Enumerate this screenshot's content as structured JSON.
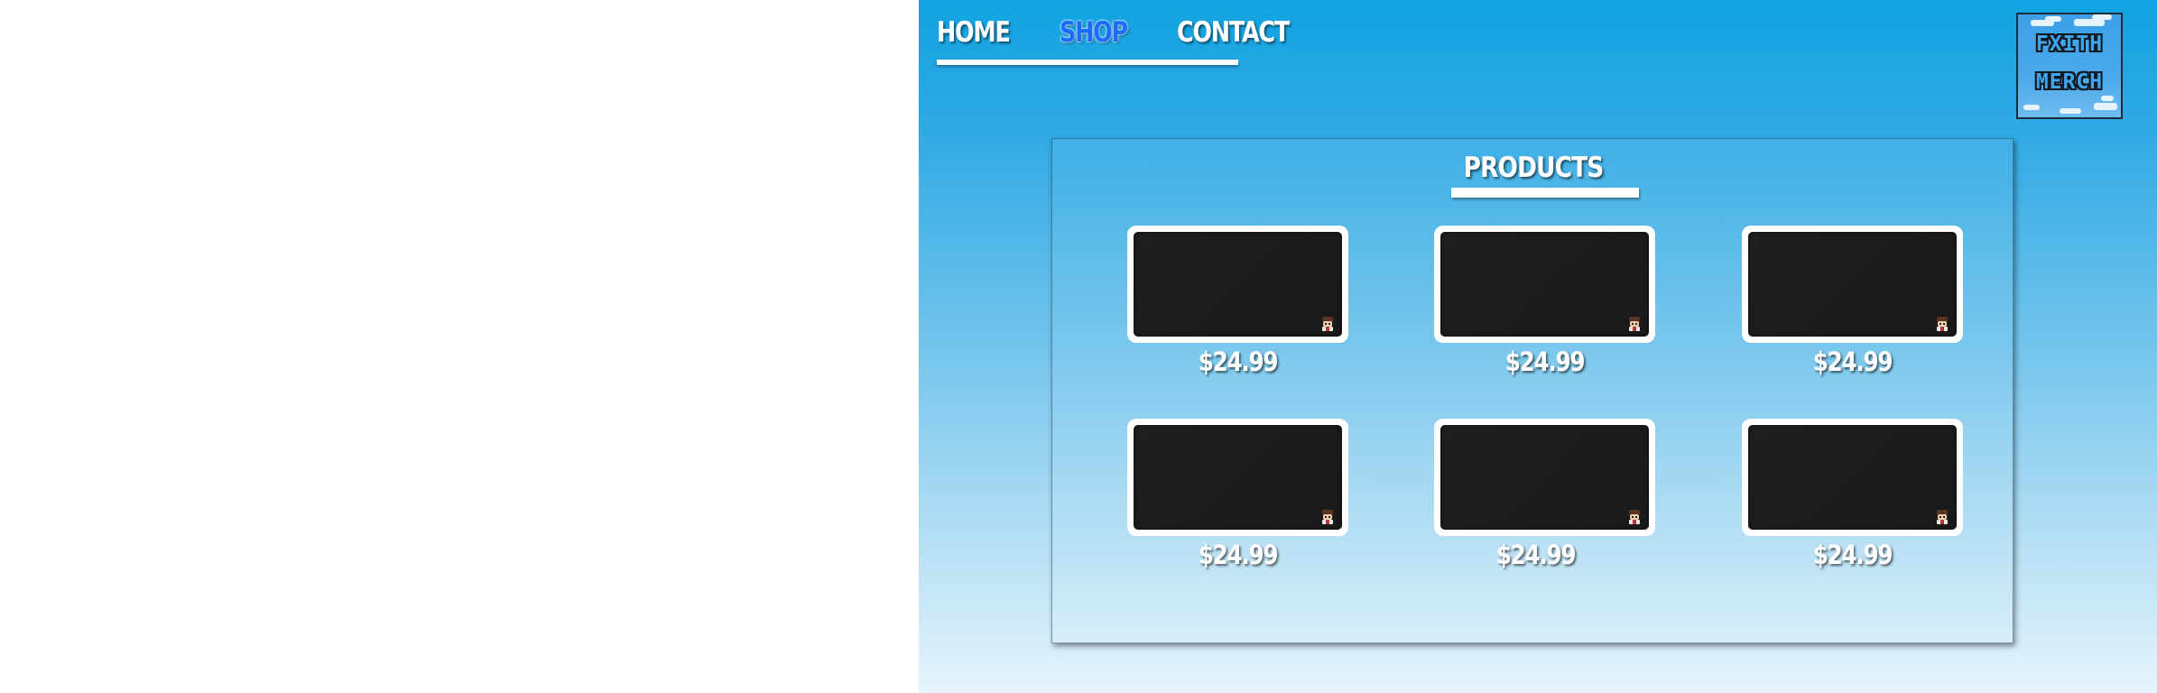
{
  "nav": {
    "items": [
      {
        "label": "HOME",
        "active": false
      },
      {
        "label": "SHOP",
        "active": true
      },
      {
        "label": "CONTACT",
        "active": false
      }
    ]
  },
  "logo": {
    "line1": "FXITH",
    "line2": "MERCH"
  },
  "products_section": {
    "title": "PRODUCTS",
    "items": [
      {
        "price": "$24.99",
        "icon": "mascot-icon"
      },
      {
        "price": "$24.99",
        "icon": "mascot-icon"
      },
      {
        "price": "$24.99",
        "icon": "mascot-icon"
      },
      {
        "price": "$24.99",
        "icon": "mascot-icon"
      },
      {
        "price": "$24.99",
        "icon": "mascot-icon"
      },
      {
        "price": "$24.99",
        "icon": "mascot-icon"
      }
    ]
  },
  "colors": {
    "sky_top": "#11a3e2",
    "sky_bottom": "#e6f4fc",
    "nav_active": "#1a6dff",
    "card_image": "#1c1c1c",
    "card_frame": "#ffffff"
  }
}
